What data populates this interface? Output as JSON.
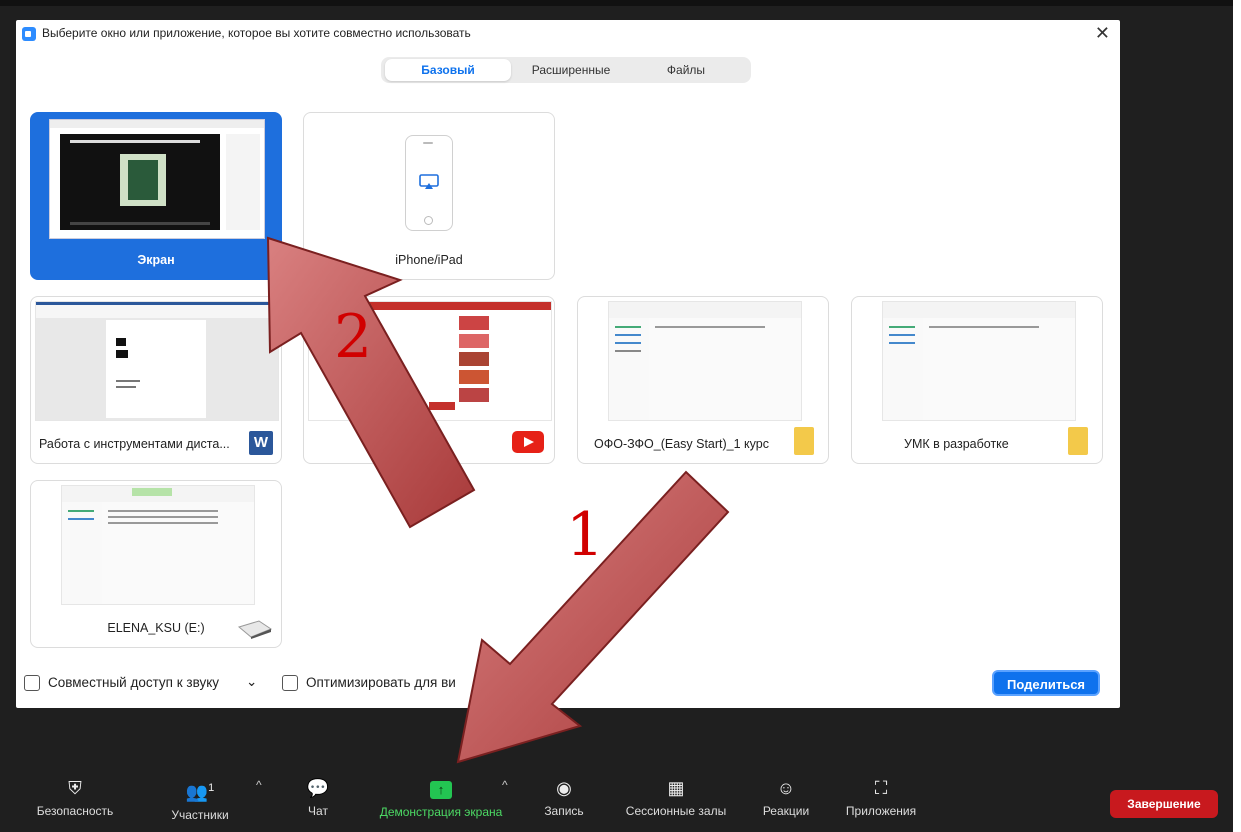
{
  "dialog": {
    "title": "Выберите окно или приложение, которое вы хотите совместно использовать",
    "close_label": "✕",
    "tabs": [
      {
        "label": "Базовый",
        "active": true
      },
      {
        "label": "Расширенные",
        "active": false
      },
      {
        "label": "Файлы",
        "active": false
      }
    ],
    "tiles": [
      {
        "label": "Экран",
        "selected": true
      },
      {
        "label": "iPhone/iPad"
      },
      {
        "label": "Работа с инструментами диста..."
      },
      {
        "label": ""
      },
      {
        "label": "ОФО-ЗФО_(Easy Start)_1 курс"
      },
      {
        "label": "УМК в разработке"
      },
      {
        "label": "ELENA_KSU (E:)"
      }
    ],
    "share_sound_label": "Совместный доступ к звуку",
    "share_sound_caret": "⌄",
    "optimize_label": "Оптимизировать для ви",
    "share_button": "Поделиться"
  },
  "toolbar": {
    "items": [
      {
        "label": "Безопасность",
        "icon": "shield-icon"
      },
      {
        "label": "Участники",
        "icon": "participants-icon",
        "count": "1"
      },
      {
        "label": "Чат",
        "icon": "chat-icon"
      },
      {
        "label": "Демонстрация экрана",
        "icon": "share-screen-icon"
      },
      {
        "label": "Запись",
        "icon": "record-icon"
      },
      {
        "label": "Сессионные залы",
        "icon": "breakout-rooms-icon"
      },
      {
        "label": "Реакции",
        "icon": "reactions-icon"
      },
      {
        "label": "Приложения",
        "icon": "apps-icon"
      }
    ],
    "caret": "^",
    "end_button": "Завершение"
  },
  "annotations": {
    "arrow1_number": "1",
    "arrow2_number": "2"
  },
  "colors": {
    "accent": "#0e72ed",
    "end_button": "#c8191e",
    "share_active": "#4cd964",
    "annotation_arrow": "#b84848"
  }
}
